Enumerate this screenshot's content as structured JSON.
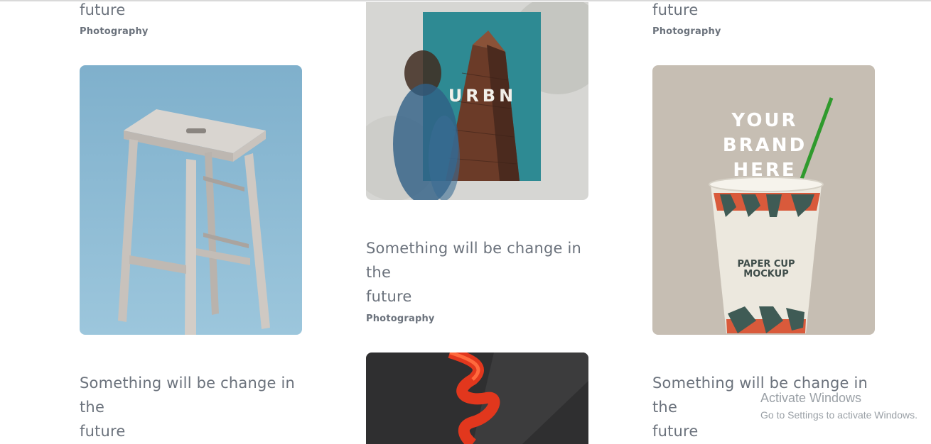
{
  "page": {
    "accent_text_color": "#6b727c"
  },
  "col1": {
    "top_title_tail": "future",
    "top_category": "Photography",
    "image": "wooden-stool-photo",
    "bottom_title": {
      "line1": "Something will be change in",
      "line2": "the",
      "line3": "future"
    }
  },
  "col2": {
    "image_top": "urbn-poster-mockup-photo",
    "poster_text": "URBN",
    "title": {
      "line1": "Something will be change in",
      "line2": "the",
      "line3": "future"
    },
    "category": "Photography",
    "image_bottom": "red-ribbon-photo"
  },
  "col3": {
    "top_title_tail": "future",
    "top_category": "Photography",
    "image": "paper-cup-mockup-photo",
    "cup_brand_lines": [
      "YOUR",
      "BRAND",
      "HERE"
    ],
    "cup_label_lines": [
      "PAPER CUP",
      "MOCKUP"
    ],
    "bottom_title": {
      "line1": "Something will be change in",
      "line2": "the",
      "line3": "future"
    }
  },
  "os_watermark": {
    "title": "Activate Windows",
    "subtitle": "Go to Settings to activate Windows."
  }
}
